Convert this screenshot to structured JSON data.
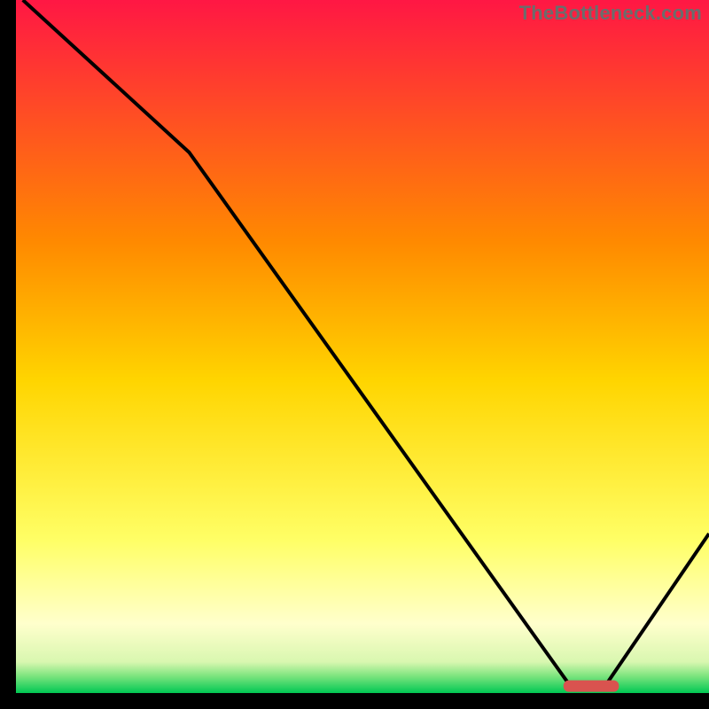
{
  "attribution": "TheBottleneck.com",
  "chart_data": {
    "type": "line",
    "title": "",
    "xlabel": "",
    "ylabel": "",
    "xlim": [
      0,
      100
    ],
    "ylim": [
      0,
      100
    ],
    "grid": false,
    "legend": false,
    "x": [
      1,
      25,
      80,
      85,
      100
    ],
    "y": [
      100,
      78,
      1,
      1,
      23
    ],
    "marker": {
      "x_range": [
        79,
        87
      ],
      "y": 1,
      "color": "#d9534f"
    },
    "gradient_stops": [
      {
        "offset": 0.0,
        "color": "#ff1744"
      },
      {
        "offset": 0.35,
        "color": "#ff8a00"
      },
      {
        "offset": 0.55,
        "color": "#ffd500"
      },
      {
        "offset": 0.78,
        "color": "#ffff66"
      },
      {
        "offset": 0.9,
        "color": "#ffffcc"
      },
      {
        "offset": 0.955,
        "color": "#d9f7b0"
      },
      {
        "offset": 0.975,
        "color": "#7fe57f"
      },
      {
        "offset": 1.0,
        "color": "#00c853"
      }
    ],
    "frame_color": "#000000",
    "curve_color": "#000000",
    "axis_thickness": 18,
    "curve_thickness": 4
  }
}
